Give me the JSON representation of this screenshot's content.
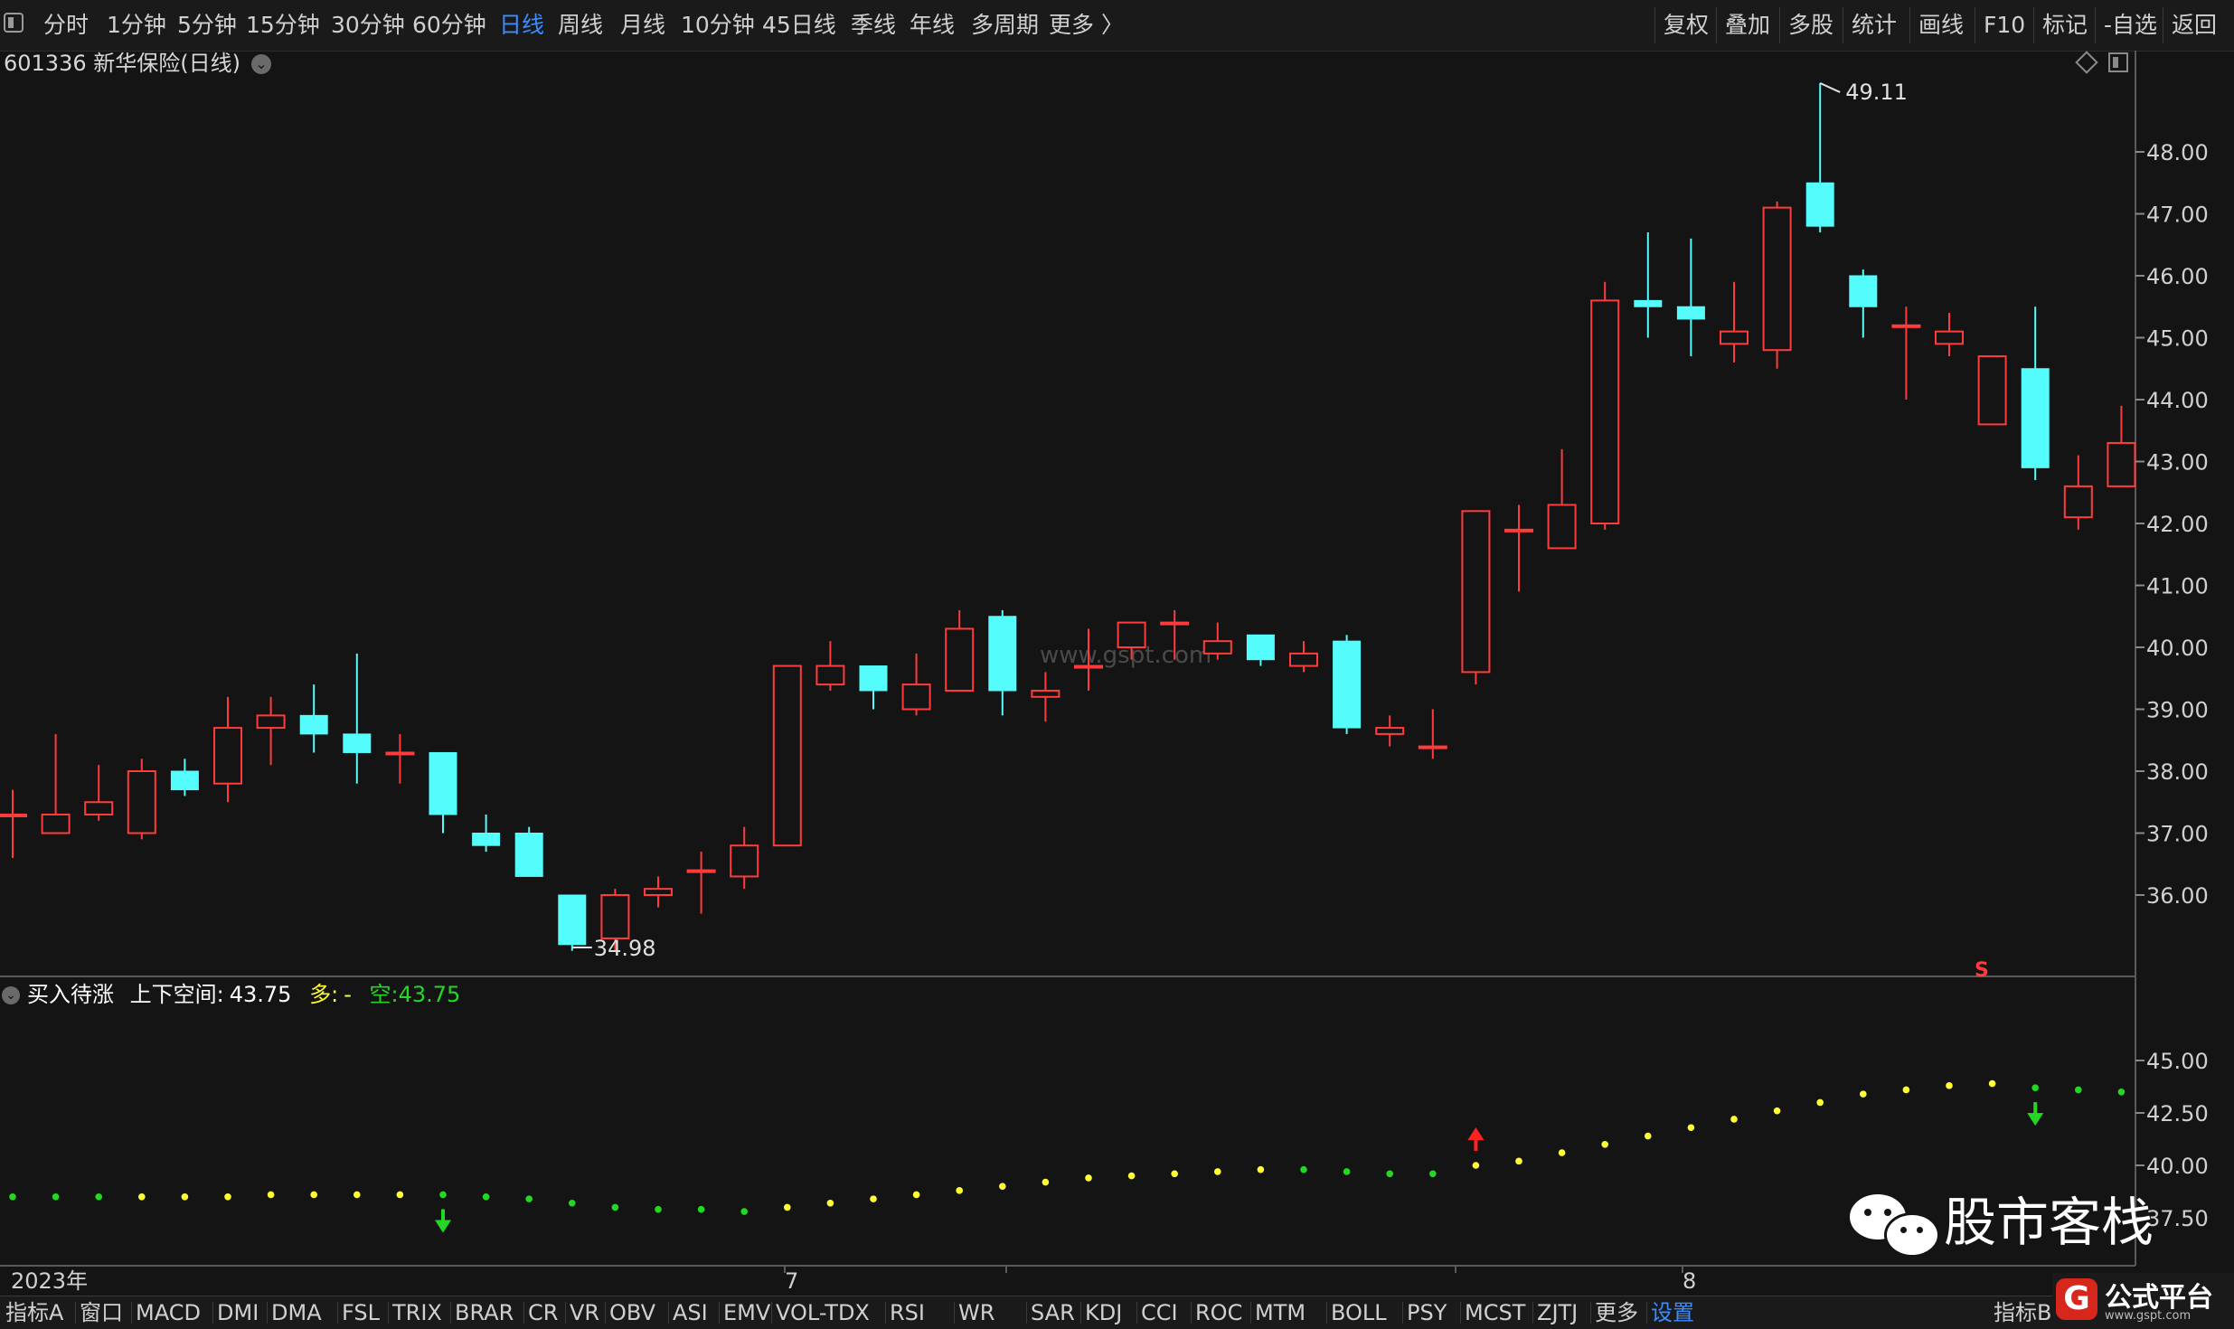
{
  "toolbar": {
    "window_icon": "window-icon",
    "periods": [
      "分时",
      "1分钟",
      "5分钟",
      "15分钟",
      "30分钟",
      "60分钟",
      "日线",
      "周线",
      "月线",
      "10分钟",
      "45日线",
      "季线",
      "年线",
      "多周期",
      "更多 〉"
    ],
    "active_period": "日线",
    "right_items": [
      "复权",
      "叠加",
      "多股",
      "统计",
      "画线",
      "F10",
      "标记",
      "-自选",
      "返回"
    ]
  },
  "chart_header": {
    "title": "601336 新华保险(日线)"
  },
  "main_chart": {
    "high_label": "49.11",
    "low_label": "34.98",
    "watermark": "www.gspt.com",
    "s_marker": "S"
  },
  "indicator_header": {
    "name": "买入待涨",
    "label1": "上下空间:",
    "value1": "43.75",
    "label2": "多:",
    "value2": "-",
    "label3": "空:",
    "value3": "43.75"
  },
  "time_axis": {
    "labels": [
      "2023年",
      "7",
      "8"
    ]
  },
  "wechat_brand": "股市客栈",
  "bottom_tabs": [
    "指标A",
    "窗口",
    "MACD",
    "DMI",
    "DMA",
    "FSL",
    "TRIX",
    "BRAR",
    "CR",
    "VR",
    "OBV",
    "ASI",
    "EMV",
    "VOL-TDX",
    "RSI",
    "WR",
    "SAR",
    "KDJ",
    "CCI",
    "ROC",
    "MTM",
    "BOLL",
    "PSY",
    "MCST",
    "ZJTJ",
    "更多",
    "设置"
  ],
  "bottom_active": "设置",
  "bottom_right_tab": "指标B",
  "logo": {
    "name": "公式平台",
    "url": "www.gspt.com",
    "badge": "G"
  },
  "colors": {
    "up": "#ff3b3b",
    "down": "#54fcfc",
    "dot_green": "#22d822",
    "dot_yellow": "#ffff33",
    "accent": "#3b8cff"
  },
  "chart_data": [
    {
      "type": "candlestick",
      "title": "601336 新华保险(日线)",
      "y_ticks": [
        48.0,
        47.0,
        46.0,
        45.0,
        44.0,
        43.0,
        42.0,
        41.0,
        40.0,
        39.0,
        38.0,
        37.0,
        36.0
      ],
      "x_labels": [
        "2023年",
        "7",
        "8"
      ],
      "ylim": [
        35.0,
        49.5
      ],
      "candles": [
        {
          "o": 37.3,
          "c": 37.3,
          "h": 37.7,
          "l": 36.6
        },
        {
          "o": 37.0,
          "c": 37.3,
          "h": 38.6,
          "l": 37.0
        },
        {
          "o": 37.3,
          "c": 37.5,
          "h": 38.1,
          "l": 37.2
        },
        {
          "o": 37.0,
          "c": 38.0,
          "h": 38.2,
          "l": 36.9
        },
        {
          "o": 38.0,
          "c": 37.7,
          "h": 38.2,
          "l": 37.6
        },
        {
          "o": 37.8,
          "c": 38.7,
          "h": 39.2,
          "l": 37.5
        },
        {
          "o": 38.7,
          "c": 38.9,
          "h": 39.2,
          "l": 38.1
        },
        {
          "o": 38.9,
          "c": 38.6,
          "h": 39.4,
          "l": 38.3
        },
        {
          "o": 38.6,
          "c": 38.3,
          "h": 39.9,
          "l": 37.8
        },
        {
          "o": 38.3,
          "c": 38.3,
          "h": 38.6,
          "l": 37.8
        },
        {
          "o": 38.3,
          "c": 37.3,
          "h": 38.3,
          "l": 37.0
        },
        {
          "o": 37.0,
          "c": 36.8,
          "h": 37.3,
          "l": 36.7
        },
        {
          "o": 37.0,
          "c": 36.3,
          "h": 37.1,
          "l": 36.3
        },
        {
          "o": 36.0,
          "c": 35.2,
          "h": 36.0,
          "l": 35.1
        },
        {
          "o": 35.3,
          "c": 36.0,
          "h": 36.1,
          "l": 35.1
        },
        {
          "o": 36.0,
          "c": 36.1,
          "h": 36.3,
          "l": 35.8
        },
        {
          "o": 36.4,
          "c": 36.4,
          "h": 36.7,
          "l": 35.7
        },
        {
          "o": 36.3,
          "c": 36.8,
          "h": 37.1,
          "l": 36.1
        },
        {
          "o": 36.8,
          "c": 39.7,
          "h": 39.7,
          "l": 36.8
        },
        {
          "o": 39.4,
          "c": 39.7,
          "h": 40.1,
          "l": 39.3
        },
        {
          "o": 39.7,
          "c": 39.3,
          "h": 39.7,
          "l": 39.0
        },
        {
          "o": 39.0,
          "c": 39.4,
          "h": 39.9,
          "l": 38.9
        },
        {
          "o": 39.3,
          "c": 40.3,
          "h": 40.6,
          "l": 39.3
        },
        {
          "o": 40.5,
          "c": 39.3,
          "h": 40.6,
          "l": 38.9
        },
        {
          "o": 39.2,
          "c": 39.3,
          "h": 39.6,
          "l": 38.8
        },
        {
          "o": 39.7,
          "c": 39.7,
          "h": 40.3,
          "l": 39.3
        },
        {
          "o": 40.0,
          "c": 40.4,
          "h": 40.4,
          "l": 39.8
        },
        {
          "o": 40.4,
          "c": 40.4,
          "h": 40.6,
          "l": 39.8
        },
        {
          "o": 39.9,
          "c": 40.1,
          "h": 40.4,
          "l": 39.8
        },
        {
          "o": 40.2,
          "c": 39.8,
          "h": 40.2,
          "l": 39.7
        },
        {
          "o": 39.7,
          "c": 39.9,
          "h": 40.1,
          "l": 39.6
        },
        {
          "o": 40.1,
          "c": 38.7,
          "h": 40.2,
          "l": 38.6
        },
        {
          "o": 38.6,
          "c": 38.7,
          "h": 38.9,
          "l": 38.4
        },
        {
          "o": 38.4,
          "c": 38.4,
          "h": 39.0,
          "l": 38.2
        },
        {
          "o": 39.6,
          "c": 42.2,
          "h": 42.2,
          "l": 39.4
        },
        {
          "o": 41.9,
          "c": 41.9,
          "h": 42.3,
          "l": 40.9
        },
        {
          "o": 41.6,
          "c": 42.3,
          "h": 43.2,
          "l": 41.6
        },
        {
          "o": 42.0,
          "c": 45.6,
          "h": 45.9,
          "l": 41.9
        },
        {
          "o": 45.6,
          "c": 45.5,
          "h": 46.7,
          "l": 45.0
        },
        {
          "o": 45.5,
          "c": 45.3,
          "h": 46.6,
          "l": 44.7
        },
        {
          "o": 44.9,
          "c": 45.1,
          "h": 45.9,
          "l": 44.6
        },
        {
          "o": 44.8,
          "c": 47.1,
          "h": 47.2,
          "l": 44.5
        },
        {
          "o": 47.5,
          "c": 46.8,
          "h": 49.11,
          "l": 46.7
        },
        {
          "o": 46.0,
          "c": 45.5,
          "h": 46.1,
          "l": 45.0
        },
        {
          "o": 45.2,
          "c": 45.2,
          "h": 45.5,
          "l": 44.0
        },
        {
          "o": 44.9,
          "c": 45.1,
          "h": 45.4,
          "l": 44.7
        },
        {
          "o": 43.6,
          "c": 44.7,
          "h": 44.7,
          "l": 43.6
        },
        {
          "o": 44.5,
          "c": 42.9,
          "h": 45.5,
          "l": 42.7
        },
        {
          "o": 42.1,
          "c": 42.6,
          "h": 43.1,
          "l": 41.9
        },
        {
          "o": 42.6,
          "c": 43.3,
          "h": 43.9,
          "l": 42.6
        }
      ],
      "high_marker": {
        "value": 49.11
      },
      "low_marker": {
        "value": 34.98
      }
    },
    {
      "type": "scatter",
      "title": "买入待涨",
      "y_ticks": [
        45.0,
        42.5,
        40.0,
        37.5
      ],
      "ylim": [
        36.0,
        47.0
      ],
      "values": [
        38.5,
        38.5,
        38.5,
        38.5,
        38.5,
        38.5,
        38.6,
        38.6,
        38.6,
        38.6,
        38.6,
        38.5,
        38.4,
        38.2,
        38.0,
        37.9,
        37.9,
        37.8,
        38.0,
        38.2,
        38.4,
        38.6,
        38.8,
        39.0,
        39.2,
        39.4,
        39.5,
        39.6,
        39.7,
        39.8,
        39.8,
        39.7,
        39.6,
        39.6,
        40.0,
        40.2,
        40.6,
        41.0,
        41.4,
        41.8,
        42.2,
        42.6,
        43.0,
        43.4,
        43.6,
        43.8,
        43.9,
        43.7,
        43.6,
        43.5
      ],
      "colors": [
        "g",
        "g",
        "g",
        "y",
        "y",
        "y",
        "y",
        "y",
        "y",
        "y",
        "g",
        "g",
        "g",
        "g",
        "g",
        "g",
        "g",
        "g",
        "y",
        "y",
        "y",
        "y",
        "y",
        "y",
        "y",
        "y",
        "y",
        "y",
        "y",
        "y",
        "g",
        "g",
        "g",
        "g",
        "y",
        "y",
        "y",
        "y",
        "y",
        "y",
        "y",
        "y",
        "y",
        "y",
        "y",
        "y",
        "y",
        "g",
        "g",
        "g"
      ],
      "up_arrow_index": 34,
      "down_arrow_indexes": [
        10,
        47
      ]
    }
  ]
}
